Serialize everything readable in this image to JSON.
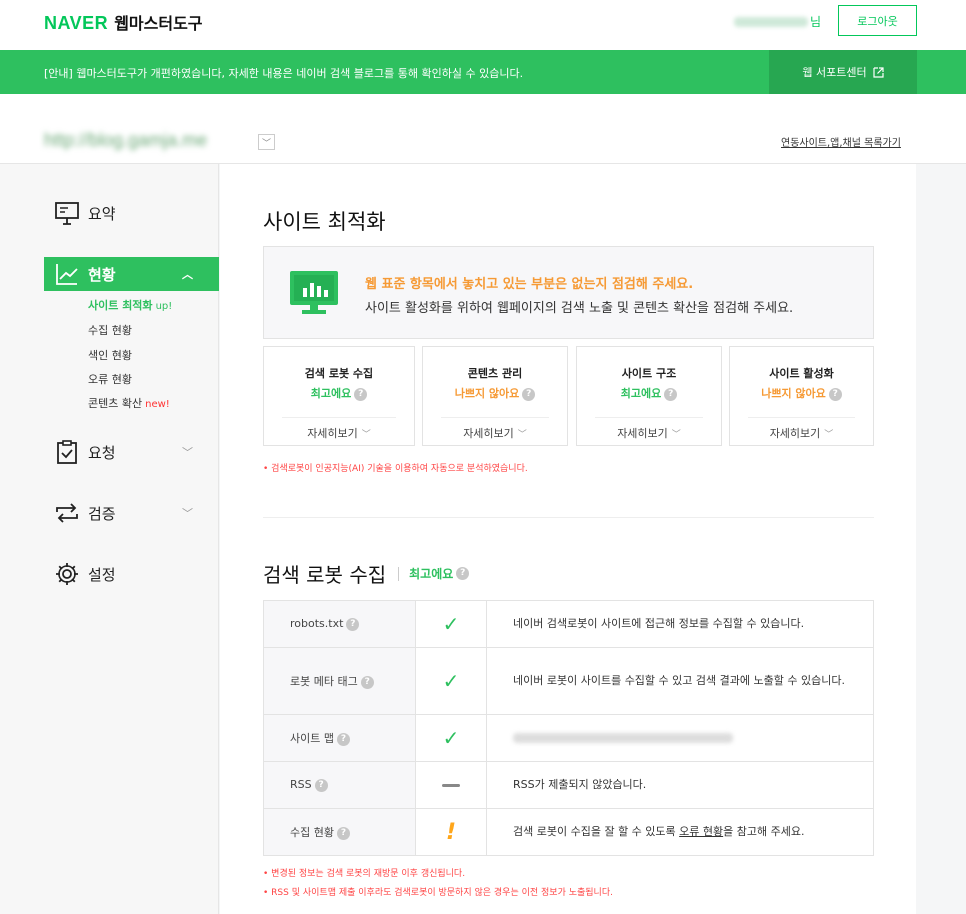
{
  "header": {
    "logo_brand": "NAVER",
    "logo_title": "웹마스터도구",
    "user_suffix": "님",
    "logout_label": "로그아웃"
  },
  "notice": {
    "message": "[안내] 웹마스터도구가 개편하였습니다, 자세한 내용은 네이버 검색 블로그를 통해 확인하실 수 있습니다.",
    "support_label": "웹 서포트센터"
  },
  "sitebar": {
    "site_url": "http://blog.gamja.me",
    "linked_label": "연동사이트,앱,채널 목록가기"
  },
  "sidebar": {
    "items": [
      {
        "label": "요약",
        "icon": "presentation-board-icon"
      },
      {
        "label": "현황",
        "icon": "line-chart-icon"
      },
      {
        "label": "요청",
        "icon": "clipboard-check-icon"
      },
      {
        "label": "검증",
        "icon": "repeat-arrows-icon"
      },
      {
        "label": "설정",
        "icon": "gear-icon"
      }
    ],
    "subitems": [
      {
        "label": "사이트 최적화",
        "tag": "up!"
      },
      {
        "label": "수집 현황"
      },
      {
        "label": "색인 현황"
      },
      {
        "label": "오류 현황"
      },
      {
        "label": "콘텐츠 확산",
        "tag": "new!"
      }
    ]
  },
  "main": {
    "title": "사이트 최적화",
    "intro_line1": "웹 표준 항목에서 놓치고 있는 부분은 없는지 점검해 주세요.",
    "intro_line2": "사이트 활성화를 위하여 웹페이지의 검색 노출 및 콘텐츠 확산을 점검해 주세요.",
    "cards": [
      {
        "title": "검색 로봇 수집",
        "status": "최고에요",
        "more": "자세히보기"
      },
      {
        "title": "콘텐츠 관리",
        "status": "나쁘지 않아요",
        "more": "자세히보기"
      },
      {
        "title": "사이트 구조",
        "status": "최고에요",
        "more": "자세히보기"
      },
      {
        "title": "사이트 활성화",
        "status": "나쁘지 않아요",
        "more": "자세히보기"
      }
    ],
    "ai_note": "• 검색로봇이 인공지능(AI) 기술을 이용하여 자동으로 분석하였습니다.",
    "section_title": "검색 로봇 수집",
    "section_status": "최고에요",
    "rows": [
      {
        "name": "robots.txt",
        "desc": "네이버 검색로봇이 사이트에 접근해 정보를 수집할 수 있습니다."
      },
      {
        "name": "로봇 메타 태그",
        "desc": "네이버 로봇이 사이트를 수집할 수 있고 검색 결과에 노출할 수 있습니다."
      },
      {
        "name": "사이트 맵",
        "desc": "http://blog.gamja.me/sitemap_index.xml"
      },
      {
        "name": "RSS",
        "desc": "RSS가 제출되지 않았습니다."
      },
      {
        "name": "수집 현황",
        "desc_before": "검색 로봇이 수집을 잘 할 수 있도록 ",
        "desc_link": "오류 현황",
        "desc_after": "을 참고해 주세요."
      }
    ],
    "footnote1": "• 변경된 정보는 검색 로봇의 재방문 이후 갱신됩니다.",
    "footnote2": "• RSS 및 사이트맵 제출 이후라도 검색로봇이 방문하지 않은 경우는 이전 정보가 노출됩니다."
  },
  "colors": {
    "brand_green": "#2ec05f",
    "dark_green": "#27a751",
    "orange": "#f69a35",
    "red_note": "#ff4444"
  }
}
